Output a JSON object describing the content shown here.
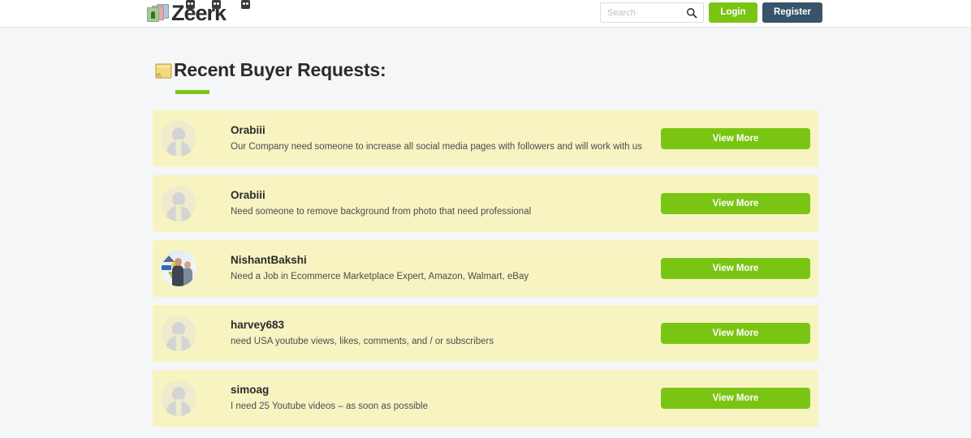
{
  "header": {
    "brand": {
      "name": "Zeerk",
      "logo_icon": "stacked-photo-frames-icon"
    },
    "search": {
      "placeholder": "Search",
      "value": "",
      "icon": "search-icon"
    },
    "login_label": "Login",
    "register_label": "Register",
    "colors": {
      "login_green": "#7ac514",
      "register_slate": "#38536a",
      "header_background": "#ffffff"
    }
  },
  "main": {
    "title": "Recent Buyer Requests:",
    "title_icon": "note-icon",
    "underline_color": "#7ac514",
    "page_background": "#f5f6f8",
    "card_background": "#f7f4c2",
    "view_more_label": "View More",
    "requests": [
      {
        "user": "Orabiii",
        "description": "Our Company need someone to increase all social media pages with followers and will work with us",
        "avatar": "placeholder",
        "action_label": "View More"
      },
      {
        "user": "Orabiii",
        "description": "Need someone to remove background from photo that need professional",
        "avatar": "placeholder",
        "action_label": "View More"
      },
      {
        "user": "NishantBakshi",
        "description": "Need a Job in Ecommerce Marketplace Expert, Amazon, Walmart, eBay",
        "avatar": "photo",
        "action_label": "View More"
      },
      {
        "user": "harvey683",
        "description": "need USA youtube views, likes, comments, and / or subscribers",
        "avatar": "placeholder",
        "action_label": "View More"
      },
      {
        "user": "simoag",
        "description": "I need 25 Youtube videos – as soon as possible",
        "avatar": "placeholder",
        "action_label": "View More"
      }
    ]
  }
}
